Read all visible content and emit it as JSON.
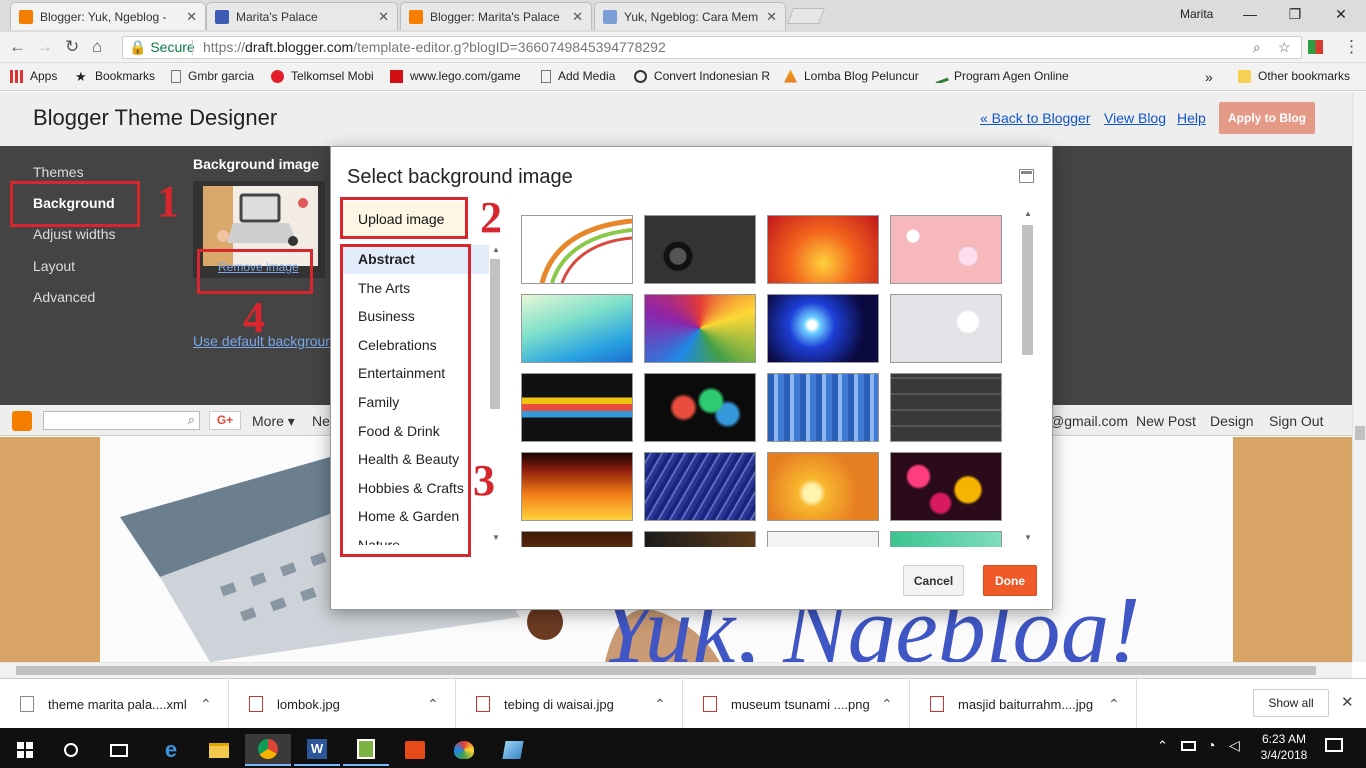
{
  "browser": {
    "tabs": [
      {
        "title": "Blogger: Yuk, Ngeblog - ",
        "favicon_color": "#f57d00",
        "active": true
      },
      {
        "title": "Marita's Palace",
        "favicon_color": "#3b5bb5",
        "active": false
      },
      {
        "title": "Blogger: Marita's Palace",
        "favicon_color": "#f57d00",
        "active": false
      },
      {
        "title": "Yuk, Ngeblog: Cara Mem",
        "favicon_color": "#7a9fd6",
        "active": false
      }
    ],
    "profile_name": "Marita",
    "secure_label": "Secure",
    "url_prefix": "https://",
    "url_host": "draft.blogger.com",
    "url_path": "/template-editor.g?blogID=3660749845394778292",
    "bookmarks": [
      {
        "label": "Apps",
        "icon": "apps-grid-icon"
      },
      {
        "label": "Bookmarks",
        "icon": "star-icon"
      },
      {
        "label": "Gmbr garcia",
        "icon": "page-icon"
      },
      {
        "label": "Telkomsel Mobi",
        "icon": "telkomsel-icon"
      },
      {
        "label": "www.lego.com/game",
        "icon": "lego-icon"
      },
      {
        "label": "Add Media",
        "icon": "page-icon"
      },
      {
        "label": "Convert Indonesian R",
        "icon": "convert-icon"
      },
      {
        "label": "Lomba Blog Peluncur",
        "icon": "blog-icon"
      },
      {
        "label": "Program Agen Online",
        "icon": "agen-icon"
      }
    ],
    "bookmarks_overflow": "»",
    "other_bookmarks": "Other bookmarks"
  },
  "designer": {
    "title": "Blogger Theme Designer",
    "back_link": "« Back to Blogger",
    "view_blog_link": "View Blog",
    "help_link": "Help",
    "apply_button": "Apply to Blog",
    "sidebar": [
      {
        "label": "Themes",
        "selected": false
      },
      {
        "label": "Background",
        "selected": true
      },
      {
        "label": "Adjust widths",
        "selected": false
      },
      {
        "label": "Layout",
        "selected": false
      },
      {
        "label": "Advanced",
        "selected": false
      }
    ],
    "background_heading": "Background image",
    "remove_image_link": "Remove image",
    "use_default_link": "Use default background"
  },
  "blog_navbar": {
    "g_plus": "G+",
    "more": "More",
    "next_partial": "Ne",
    "email_partial": "@gmail.com",
    "new_post": "New Post",
    "design": "Design",
    "sign_out": "Sign Out"
  },
  "dialog": {
    "title": "Select background image",
    "upload_button": "Upload image",
    "categories": [
      "Abstract",
      "The Arts",
      "Business",
      "Celebrations",
      "Entertainment",
      "Family",
      "Food & Drink",
      "Health & Beauty",
      "Hobbies & Crafts",
      "Home & Garden",
      "Nature"
    ],
    "selected_category": "Abstract",
    "cancel_button": "Cancel",
    "done_button": "Done"
  },
  "annotations": [
    "1",
    "2",
    "3",
    "4"
  ],
  "downloads": [
    {
      "name": "theme marita pala....xml"
    },
    {
      "name": "lombok.jpg"
    },
    {
      "name": "tebing di waisai.jpg"
    },
    {
      "name": "museum tsunami ....png"
    },
    {
      "name": "masjid baiturrahm....jpg"
    }
  ],
  "show_all": "Show all",
  "clock": {
    "time": "6:23 AM",
    "date": "3/4/2018"
  },
  "colors": {
    "accent_orange": "#f05a28",
    "annotation_red": "#d7262d",
    "panel_dark": "#444444"
  }
}
